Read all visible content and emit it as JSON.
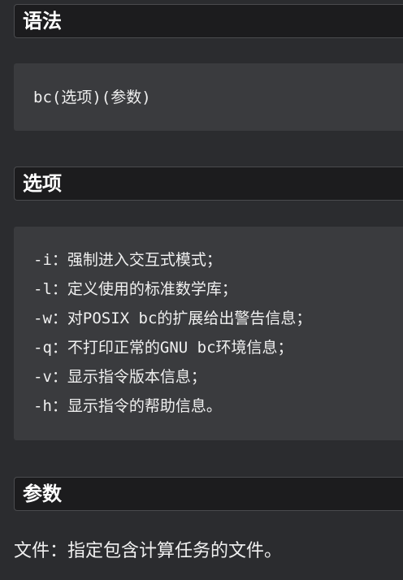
{
  "sections": {
    "syntax": {
      "heading": "语法",
      "code": "bc(选项)(参数)"
    },
    "options": {
      "heading": "选项",
      "lines": [
        "-i：强制进入交互式模式；",
        "-l：定义使用的标准数学库；",
        "-w：对POSIX bc的扩展给出警告信息；",
        "-q：不打印正常的GNU bc环境信息；",
        "-v：显示指令版本信息；",
        "-h：显示指令的帮助信息。"
      ]
    },
    "params": {
      "heading": "参数",
      "text": "文件：指定包含计算任务的文件。"
    }
  }
}
